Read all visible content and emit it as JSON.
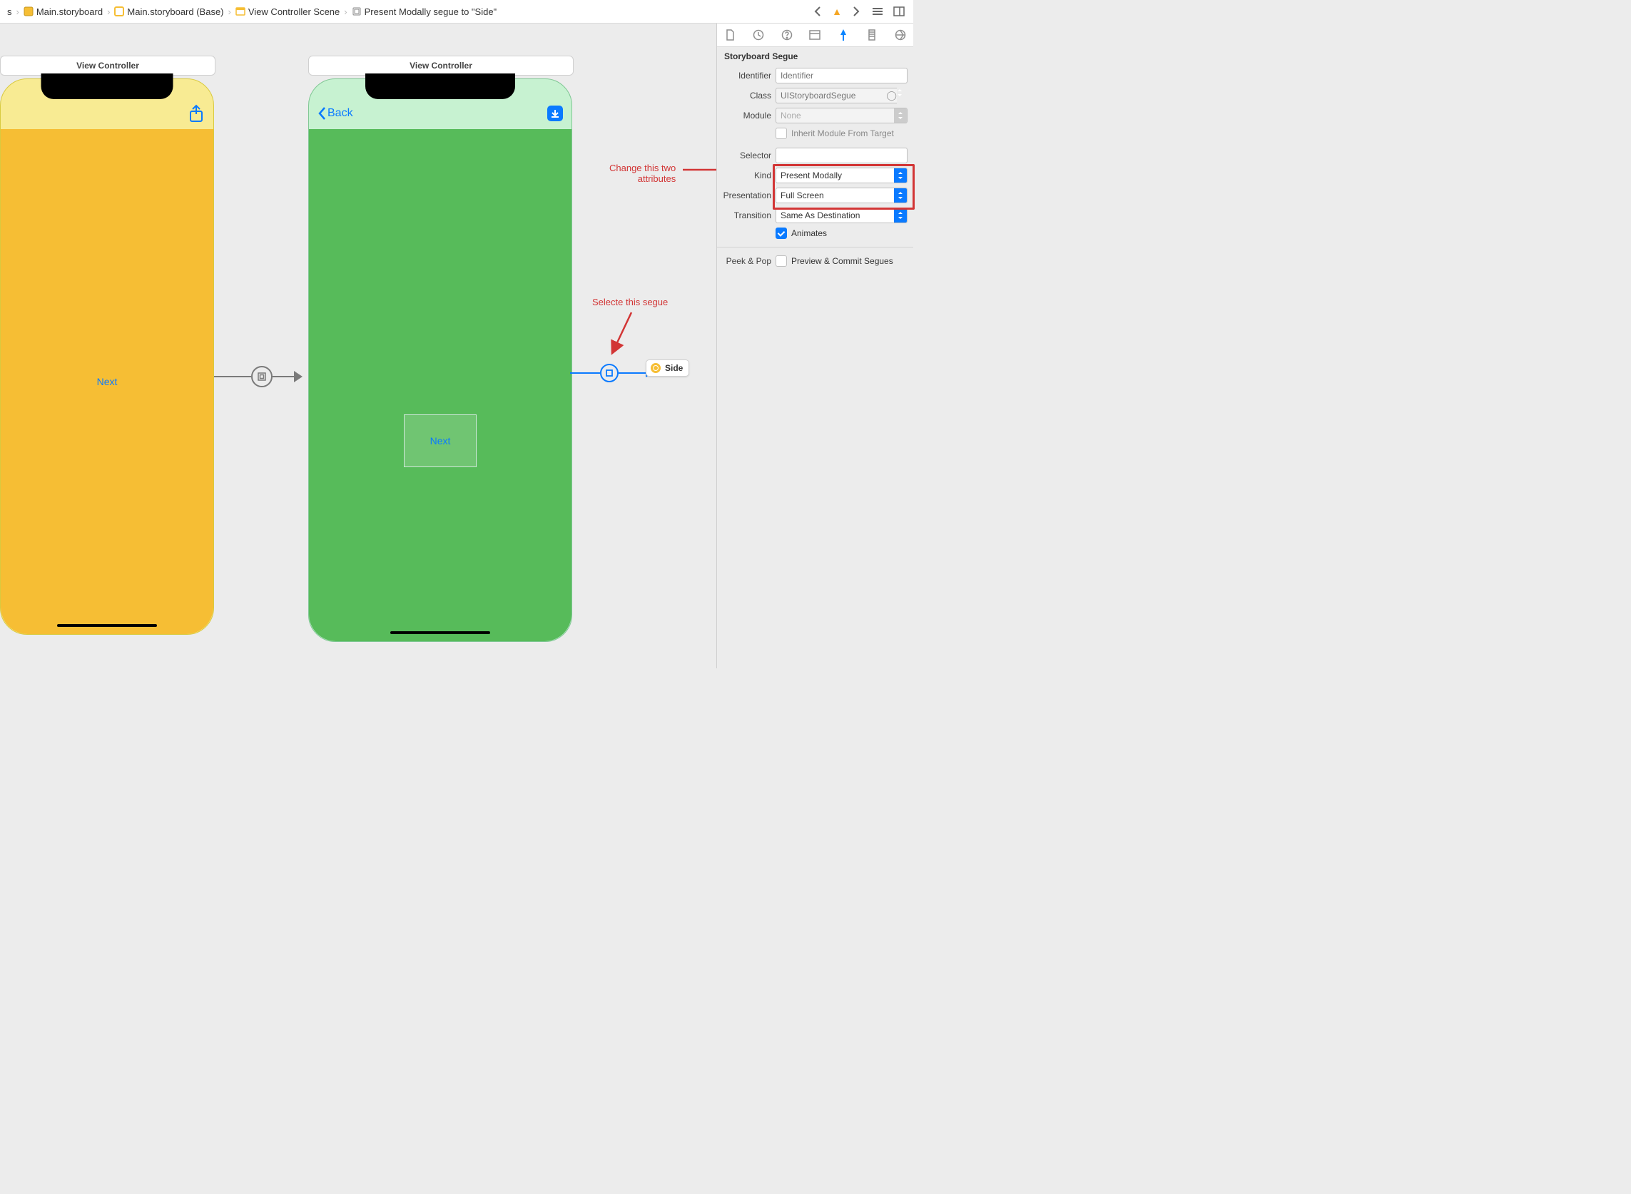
{
  "breadcrumbs": {
    "item0_suffix": "s",
    "item1": "Main.storyboard",
    "item2": "Main.storyboard (Base)",
    "item3": "View Controller Scene",
    "item4": "Present Modally segue to \"Side\""
  },
  "canvas": {
    "scene1_title": "View Controller",
    "scene2_title": "View Controller",
    "next_label": "Next",
    "back_label": "Back",
    "side_chip": "Side"
  },
  "annotations": {
    "select_segue": "Selecte this segue",
    "change_attrs_l1": "Change this two",
    "change_attrs_l2": "attributes"
  },
  "inspector": {
    "heading": "Storyboard Segue",
    "identifier_label": "Identifier",
    "identifier_placeholder": "Identifier",
    "class_label": "Class",
    "class_value": "UIStoryboardSegue",
    "module_label": "Module",
    "module_value": "None",
    "inherit_label": "Inherit Module From Target",
    "selector_label": "Selector",
    "kind_label": "Kind",
    "kind_value": "Present Modally",
    "presentation_label": "Presentation",
    "presentation_value": "Full Screen",
    "transition_label": "Transition",
    "transition_value": "Same As Destination",
    "animates_label": "Animates",
    "peek_label": "Peek & Pop",
    "peek_option": "Preview & Commit Segues"
  }
}
